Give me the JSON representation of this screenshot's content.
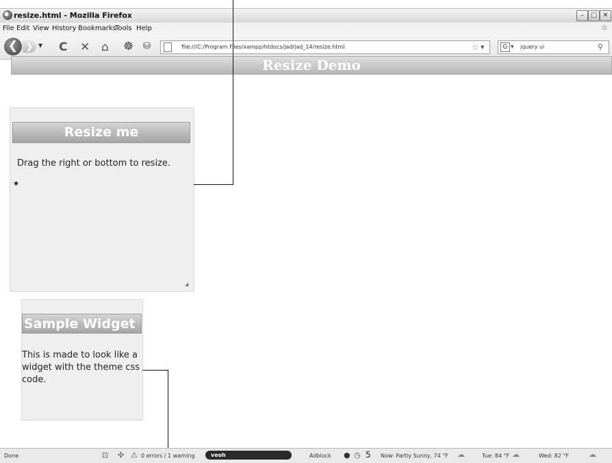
{
  "window": {
    "title": "resize.html - Mozilla Firefox",
    "min": "–",
    "max": "□",
    "close": "✕"
  },
  "menu": [
    "File",
    "Edit",
    "View",
    "History",
    "Bookmarks",
    "Tools",
    "Help"
  ],
  "nav": {
    "back": "❮",
    "forward": "❯",
    "reload": "C",
    "stop": "✕",
    "home": "⌂",
    "url": "file:///C:/Program Files/xampp/htdocs/jad/jad_14/resize.html",
    "search_value": "jquery ui",
    "search_engine": "G"
  },
  "page": {
    "header": "Resize Demo",
    "resizable": {
      "title": "Resize me",
      "text": "Drag the right or bottom to resize."
    },
    "widget": {
      "title": "Sample Widget",
      "text": "This is made to look like a widget with the theme css code."
    }
  },
  "status": {
    "left": "Done",
    "errors": "0 errors / 1 warning",
    "veoh": "veoh",
    "adblock": "Adblock",
    "count": "5",
    "now": "Now: Partly Sunny, 74 °F",
    "tue": "Tue: 84 °F",
    "wed": "Wed: 82 °F"
  }
}
